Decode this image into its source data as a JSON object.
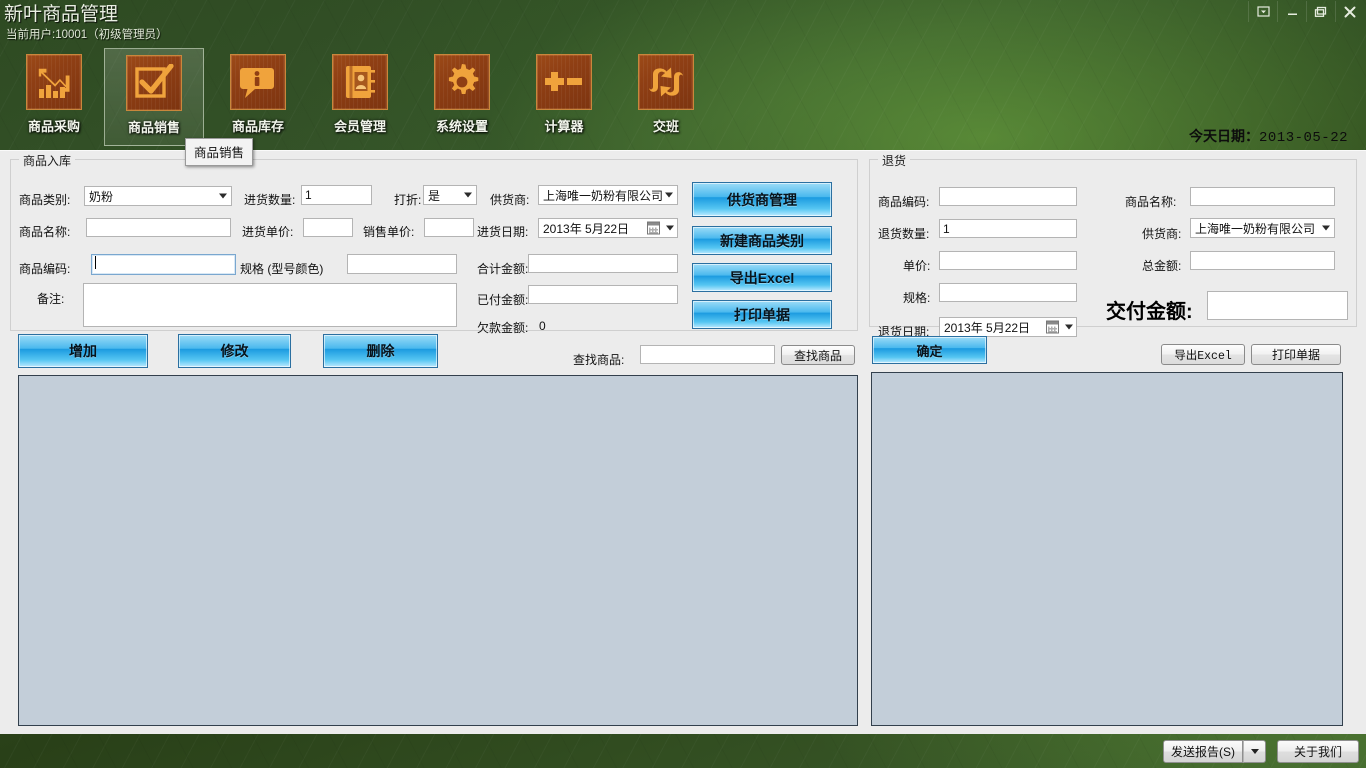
{
  "window": {
    "title": "新叶商品管理",
    "current_user_line": "当前用户:10001（初级管理员）",
    "controls": {
      "restore_down_name": "restore-window-button",
      "minimize_label": "minimize",
      "maximize_label": "maximize",
      "close_label": "close"
    }
  },
  "toolbar": {
    "items": [
      {
        "label": "商品采购",
        "icon": "chart-down-icon",
        "selected": false
      },
      {
        "label": "商品销售",
        "icon": "checkbox-check-icon",
        "selected": true
      },
      {
        "label": "商品库存",
        "icon": "info-bubble-icon",
        "selected": false
      },
      {
        "label": "会员管理",
        "icon": "address-book-icon",
        "selected": false
      },
      {
        "label": "系统设置",
        "icon": "gear-icon",
        "selected": false
      },
      {
        "label": "计算器",
        "icon": "plus-minus-icon",
        "selected": false
      },
      {
        "label": "交班",
        "icon": "shift-swap-icon",
        "selected": false
      }
    ],
    "tooltip": "商品销售"
  },
  "header": {
    "today_label": "今天日期：",
    "today_value": "2013-05-22"
  },
  "stock_in": {
    "group_title": "商品入库",
    "fields": {
      "category_label": "商品类别:",
      "category_value": "奶粉",
      "qty_label": "进货数量:",
      "qty_value": "1",
      "discount_label": "打折:",
      "discount_value": "是",
      "supplier_label": "供货商:",
      "supplier_value": "上海唯一奶粉有限公司",
      "name_label": "商品名称:",
      "name_value": "",
      "purchase_price_label": "进货单价:",
      "purchase_price_value": "",
      "sale_price_label": "销售单价:",
      "sale_price_value": "",
      "purchase_date_label": "进货日期:",
      "purchase_date_value": "2013年 5月22日",
      "code_label": "商品编码:",
      "code_value": "",
      "spec_label": "规格 (型号颜色)",
      "spec_value": "",
      "total_amount_label": "合计金额:",
      "total_amount_value": "",
      "paid_amount_label": "已付金额:",
      "paid_amount_value": "",
      "debt_label": "欠款金额:",
      "debt_value": "0",
      "note_label": "备注:",
      "note_value": ""
    },
    "side_buttons": [
      "供货商管理",
      "新建商品类别",
      "导出Excel",
      "打印单据"
    ],
    "action_buttons": [
      "增加",
      "修改",
      "删除"
    ],
    "search": {
      "label": "查找商品:",
      "value": "",
      "button": "查找商品"
    }
  },
  "returns": {
    "group_title": "退货",
    "fields": {
      "code_label": "商品编码:",
      "code_value": "",
      "name_label": "商品名称:",
      "name_value": "",
      "qty_label": "退货数量:",
      "qty_value": "1",
      "supplier_label": "供货商:",
      "supplier_value": "上海唯一奶粉有限公司",
      "price_label": "单价:",
      "price_value": "",
      "total_label": "总金额:",
      "total_value": "",
      "spec_label": "规格:",
      "spec_value": "",
      "date_label": "退货日期:",
      "date_value": "2013年 5月22日",
      "payment_label": "交付金额:",
      "payment_value": ""
    },
    "confirm_button": "确定",
    "export_button": "导出Excel",
    "print_button": "打印单据"
  },
  "statusbar": {
    "send_report": "发送报告(S)",
    "send_report_shortcut": "S",
    "about_us": "关于我们"
  },
  "colors": {
    "client_bg": "#ececec",
    "list_bg": "#c3ced9",
    "blue_button": "#49b8ee",
    "icon_orange": "#f0a33c",
    "icon_tile": "#8f3f14"
  }
}
